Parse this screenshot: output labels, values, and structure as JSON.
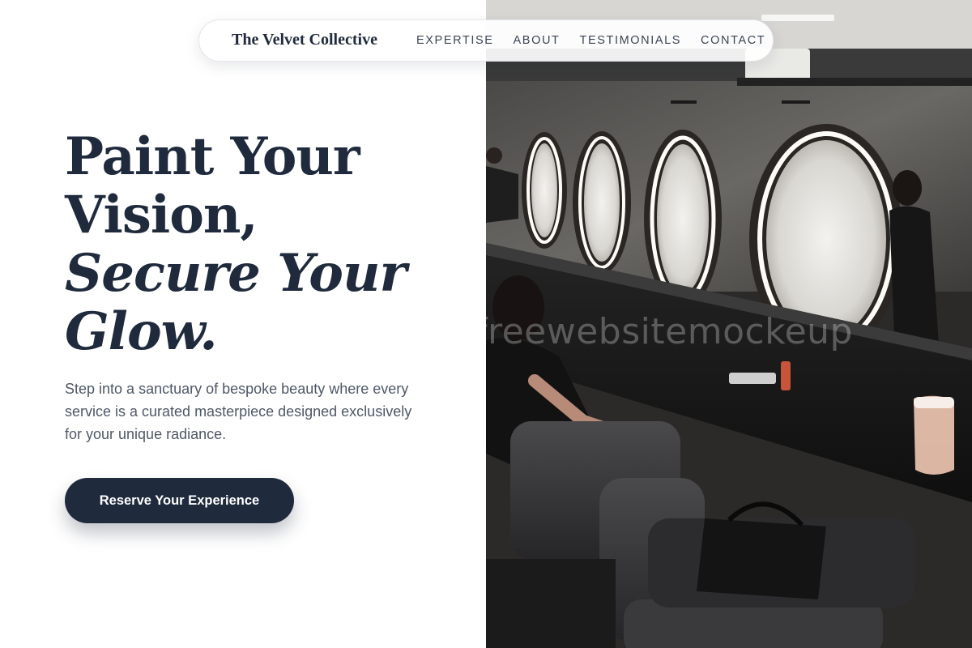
{
  "nav": {
    "brand": "The Velvet Collective",
    "links": [
      "EXPERTISE",
      "ABOUT",
      "TESTIMONIALS",
      "CONTACT"
    ]
  },
  "hero": {
    "title_line_1": "Paint Your",
    "title_line_2": "Vision,",
    "title_line_3": "Secure Your",
    "title_line_4": "Glow.",
    "subtitle": "Step into a sanctuary of bespoke beauty where every service is a curated masterpiece designed exclusively for your unique radiance.",
    "cta_label": "Reserve Your Experience"
  },
  "image": {
    "subject": "salon interior with lit round mirrors and styling chairs",
    "watermark": "freewebsitemockeup"
  },
  "colors": {
    "primary": "#1f2a3d",
    "body_text": "#4e5868",
    "background": "#ffffff"
  }
}
